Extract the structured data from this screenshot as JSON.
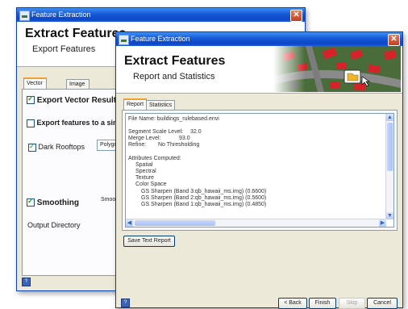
{
  "back_window": {
    "title": "Feature Extraction",
    "header_title": "Extract Features",
    "header_subtitle": "Export Features",
    "tabs": [
      "Vector Output",
      "Image Output"
    ],
    "export_vector_label": "Export Vector Result",
    "export_single_label": "Export features to a sin",
    "dark_rooftops_label": "Dark Rooftops",
    "polygon_label": "Polygon",
    "smoothing_label": "Smoothing",
    "smooth_short": "Smoo",
    "output_directory_label": "Output Directory"
  },
  "front_window": {
    "title": "Feature Extraction",
    "header_title": "Extract Features",
    "header_subtitle": "Report and Statistics",
    "tabs": [
      "Report",
      "Statistics"
    ],
    "report_lines": {
      "file_name": "File Name: buildings_rulebased.envi",
      "segment_scale_label": "Segment Scale Level:",
      "segment_scale_value": "32.0",
      "merge_label": "Merge Level:",
      "merge_value": "93.0",
      "refine_label": "Refine:",
      "refine_value": "No Thresholding",
      "attributes": "Attributes Computed:",
      "spatial": "Spatial",
      "spectral": "Spectral",
      "texture": "Texture",
      "color_space": "Color Space",
      "gs3": "GS Sharpen (Band 3:qb_hawaii_ms.img) (0.6600)",
      "gs2": "GS Sharpen (Band 2:qb_hawaii_ms.img) (0.5600)",
      "gs1": "GS Sharpen (Band 1:qb_hawaii_ms.img) (0.4850)"
    },
    "save_text_report": "Save Text Report",
    "buttons": {
      "back": "< Back",
      "finish": "Finish",
      "skip": "Skip",
      "cancel": "Cancel"
    }
  },
  "colors": {
    "titlebar_blue": "#0d47c4",
    "window_face": "#ece9d8",
    "roof_red": "#d8222a"
  },
  "icons": [
    "window-icon",
    "close-icon",
    "help-icon",
    "folder-icon",
    "cursor-icon"
  ]
}
